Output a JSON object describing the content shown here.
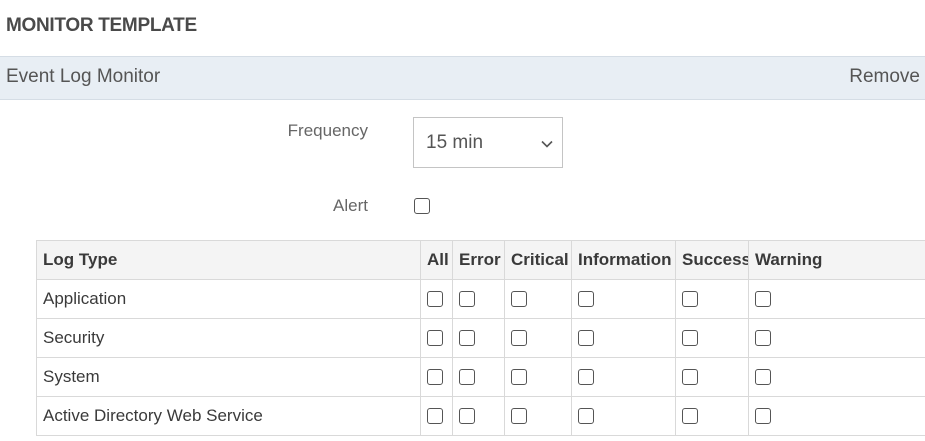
{
  "header": {
    "title": "MONITOR TEMPLATE"
  },
  "section": {
    "title": "Event Log Monitor",
    "remove_label": "Remove"
  },
  "form": {
    "frequency_label": "Frequency",
    "frequency_value": "15 min",
    "alert_label": "Alert",
    "alert_checked": false
  },
  "table": {
    "columns": [
      "Log Type",
      "All",
      "Error",
      "Critical",
      "Information",
      "Success",
      "Warning"
    ],
    "rows": [
      {
        "name": "Application"
      },
      {
        "name": "Security"
      },
      {
        "name": "System"
      },
      {
        "name": "Active Directory Web Service"
      }
    ]
  },
  "icons": {
    "select_caret": "chevron-down-icon"
  }
}
